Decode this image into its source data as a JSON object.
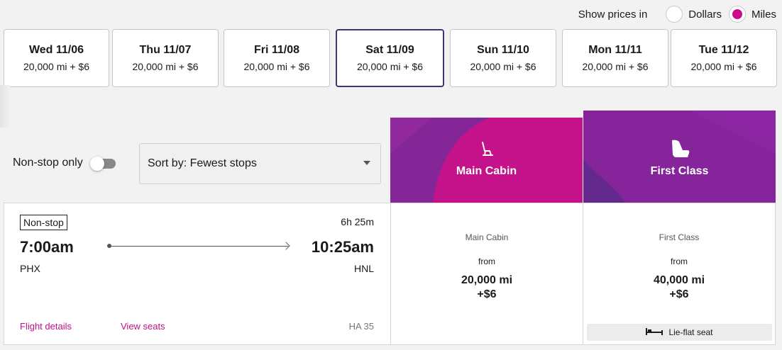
{
  "price_toggle": {
    "label": "Show prices in",
    "options": [
      {
        "label": "Dollars",
        "selected": false
      },
      {
        "label": "Miles",
        "selected": true
      }
    ]
  },
  "dates": [
    {
      "day": "Wed 11/06",
      "price": "20,000 mi + $6",
      "selected": false
    },
    {
      "day": "Thu 11/07",
      "price": "20,000 mi + $6",
      "selected": false
    },
    {
      "day": "Fri 11/08",
      "price": "20,000 mi + $6",
      "selected": false
    },
    {
      "day": "Sat 11/09",
      "price": "20,000 mi + $6",
      "selected": true
    },
    {
      "day": "Sun 11/10",
      "price": "20,000 mi + $6",
      "selected": false
    },
    {
      "day": "Mon 11/11",
      "price": "20,000 mi + $6",
      "selected": false
    },
    {
      "day": "Tue 11/12",
      "price": "20,000 mi + $6",
      "selected": false
    }
  ],
  "filters": {
    "nonstop_label": "Non-stop only",
    "nonstop_on": false,
    "sort_label": "Sort by: Fewest stops"
  },
  "cabins": {
    "main": {
      "title": "Main Cabin",
      "icon": "economy-seat-icon",
      "color": "#c4138a"
    },
    "first": {
      "title": "First Class",
      "icon": "premium-seat-icon",
      "color": "#86249b"
    }
  },
  "flight": {
    "badge": "Non-stop",
    "duration": "6h 25m",
    "depart_time": "7:00am",
    "arrive_time": "10:25am",
    "origin": "PHX",
    "destination": "HNL",
    "details_link": "Flight details",
    "seats_link": "View seats",
    "flight_number": "HA 35"
  },
  "fares": {
    "main": {
      "cabin": "Main Cabin",
      "from": "from",
      "miles": "20,000 mi",
      "fee": "+$6"
    },
    "first": {
      "cabin": "First Class",
      "from": "from",
      "miles": "40,000 mi",
      "fee": "+$6",
      "feature": "Lie-flat seat",
      "feature_icon": "bed-icon"
    }
  },
  "colors": {
    "accent": "#cc0a8c",
    "selected_border": "#3f3773",
    "link": "#c0108a"
  }
}
